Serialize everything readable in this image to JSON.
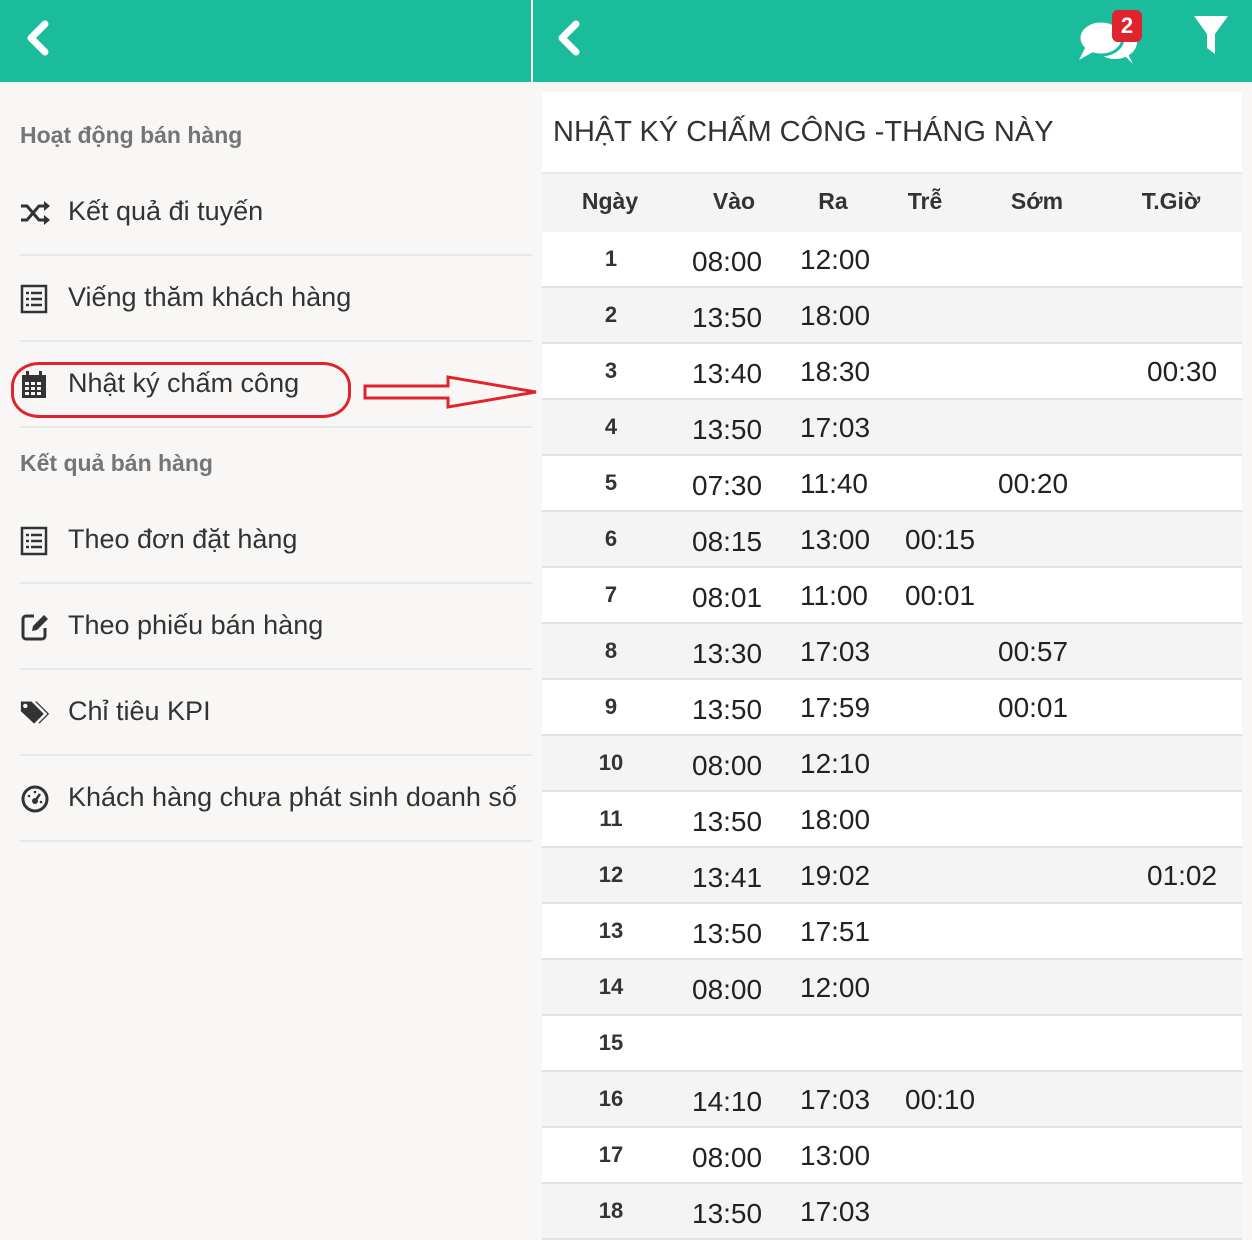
{
  "header": {
    "notification_count": "2"
  },
  "sidebar": {
    "sections": [
      {
        "title": "Hoạt động bán hàng"
      },
      {
        "title": "Kết quả bán hàng"
      }
    ],
    "items": [
      {
        "label": "Kết quả đi tuyến",
        "icon": "shuffle-icon"
      },
      {
        "label": "Viếng thăm khách hàng",
        "icon": "list-icon"
      },
      {
        "label": "Nhật ký chấm công",
        "icon": "calendar-icon"
      },
      {
        "label": "Theo đơn đặt hàng",
        "icon": "list-icon"
      },
      {
        "label": "Theo phiếu bán hàng",
        "icon": "edit-icon"
      },
      {
        "label": "Chỉ tiêu KPI",
        "icon": "tags-icon"
      },
      {
        "label": "Khách hàng chưa phát sinh doanh số",
        "icon": "dashboard-icon"
      }
    ]
  },
  "panel": {
    "title": "NHẬT KÝ CHẤM CÔNG -THÁNG NÀY",
    "columns": [
      "Ngày",
      "Vào",
      "Ra",
      "Trễ",
      "Sớm",
      "T.Giờ"
    ],
    "rows": [
      {
        "day": "1",
        "in": "08:00",
        "out": "12:00",
        "late": "",
        "early": "",
        "ot": ""
      },
      {
        "day": "2",
        "in": "13:50",
        "out": "18:00",
        "late": "",
        "early": "",
        "ot": ""
      },
      {
        "day": "3",
        "in": "13:40",
        "out": "18:30",
        "late": "",
        "early": "",
        "ot": "00:30"
      },
      {
        "day": "4",
        "in": "13:50",
        "out": "17:03",
        "late": "",
        "early": "",
        "ot": ""
      },
      {
        "day": "5",
        "in": "07:30",
        "out": "11:40",
        "late": "",
        "early": "00:20",
        "ot": ""
      },
      {
        "day": "6",
        "in": "08:15",
        "out": "13:00",
        "late": "00:15",
        "early": "",
        "ot": ""
      },
      {
        "day": "7",
        "in": "08:01",
        "out": "11:00",
        "late": "00:01",
        "early": "",
        "ot": ""
      },
      {
        "day": "8",
        "in": "13:30",
        "out": "17:03",
        "late": "",
        "early": "00:57",
        "ot": ""
      },
      {
        "day": "9",
        "in": "13:50",
        "out": "17:59",
        "late": "",
        "early": "00:01",
        "ot": ""
      },
      {
        "day": "10",
        "in": "08:00",
        "out": "12:10",
        "late": "",
        "early": "",
        "ot": ""
      },
      {
        "day": "11",
        "in": "13:50",
        "out": "18:00",
        "late": "",
        "early": "",
        "ot": ""
      },
      {
        "day": "12",
        "in": "13:41",
        "out": "19:02",
        "late": "",
        "early": "",
        "ot": "01:02"
      },
      {
        "day": "13",
        "in": "13:50",
        "out": "17:51",
        "late": "",
        "early": "",
        "ot": ""
      },
      {
        "day": "14",
        "in": "08:00",
        "out": "12:00",
        "late": "",
        "early": "",
        "ot": ""
      },
      {
        "day": "15",
        "in": "",
        "out": "",
        "late": "",
        "early": "",
        "ot": ""
      },
      {
        "day": "16",
        "in": "14:10",
        "out": "17:03",
        "late": "00:10",
        "early": "",
        "ot": ""
      },
      {
        "day": "17",
        "in": "08:00",
        "out": "13:00",
        "late": "",
        "early": "",
        "ot": ""
      },
      {
        "day": "18",
        "in": "13:50",
        "out": "17:03",
        "late": "",
        "early": "",
        "ot": ""
      }
    ]
  },
  "colors": {
    "accent": "#1abc9c",
    "badge": "#e0242f",
    "highlight": "#e0242f"
  }
}
